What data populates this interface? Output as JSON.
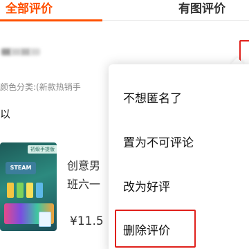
{
  "tabs": {
    "all_reviews": "全部评价",
    "with_pictures": "有图评价"
  },
  "review": {
    "sku_label": "颜色分类:(新款热销手",
    "text": "以"
  },
  "product": {
    "image_tag": "初级手提版",
    "image_logo": "STEAM",
    "title_line1": "创意男",
    "title_line2": "班六一",
    "price": "¥11.5"
  },
  "menu": {
    "items": [
      "不想匿名了",
      "置为不可评论",
      "改为好评",
      "删除评价"
    ]
  },
  "colors": {
    "accent": "#ff5000",
    "highlight": "#e0201b"
  }
}
